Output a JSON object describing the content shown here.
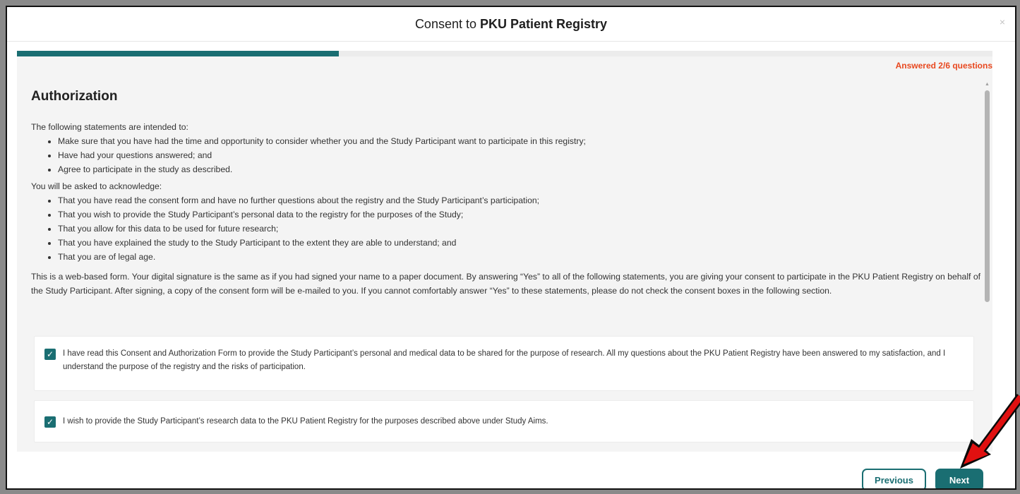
{
  "header": {
    "title_prefix": "Consent to",
    "title_bold": "PKU Patient Registry",
    "close_symbol": "×"
  },
  "progress": {
    "fraction": 0.33,
    "answered_text": "Answered 2/6 questions"
  },
  "section": {
    "heading": "Authorization",
    "intro": "The following statements are intended to:",
    "intro_bullets": [
      "Make sure that you have had the time and opportunity to consider whether you and the Study Participant want to participate in this registry;",
      "Have had your questions answered; and",
      "Agree to participate in the study as described."
    ],
    "acknowledge_intro": "You will be asked to acknowledge:",
    "acknowledge_bullets": [
      "That you have read the consent form and have no further questions about the registry and the Study Participant’s participation;",
      "That you wish to provide the Study Participant’s personal data to the registry for the purposes of the Study;",
      "That you allow for this data to be used for future research;",
      "That you have explained the study to the Study Participant to the extent they are able to understand; and",
      "That you are of legal age."
    ],
    "web_form_paragraph": "This is a web-based form. Your digital signature is the same as if you had signed your name to a paper document. By answering “Yes” to all of the following statements, you are giving your consent to participate in the PKU Patient Registry on behalf of the Study Participant. After signing, a copy of the consent form will be e-mailed to you. If you cannot comfortably answer “Yes” to these statements, please do not check the consent boxes in the following section."
  },
  "consents": [
    {
      "checked": true,
      "text": "I have read this Consent and Authorization Form to provide the Study Participant’s personal and medical data to be shared for the purpose of research. All my questions about the PKU Patient Registry have been answered to my satisfaction, and I understand the purpose of the registry and the risks of participation."
    },
    {
      "checked": true,
      "text": "I wish to provide the Study Participant’s research data to the PKU Patient Registry for the purposes described above under Study Aims."
    }
  ],
  "checkmark_symbol": "✓",
  "buttons": {
    "previous": "Previous",
    "next": "Next"
  },
  "colors": {
    "accent": "#1a6e72",
    "answered": "#e8481f",
    "annotation_arrow": "#e01010"
  }
}
